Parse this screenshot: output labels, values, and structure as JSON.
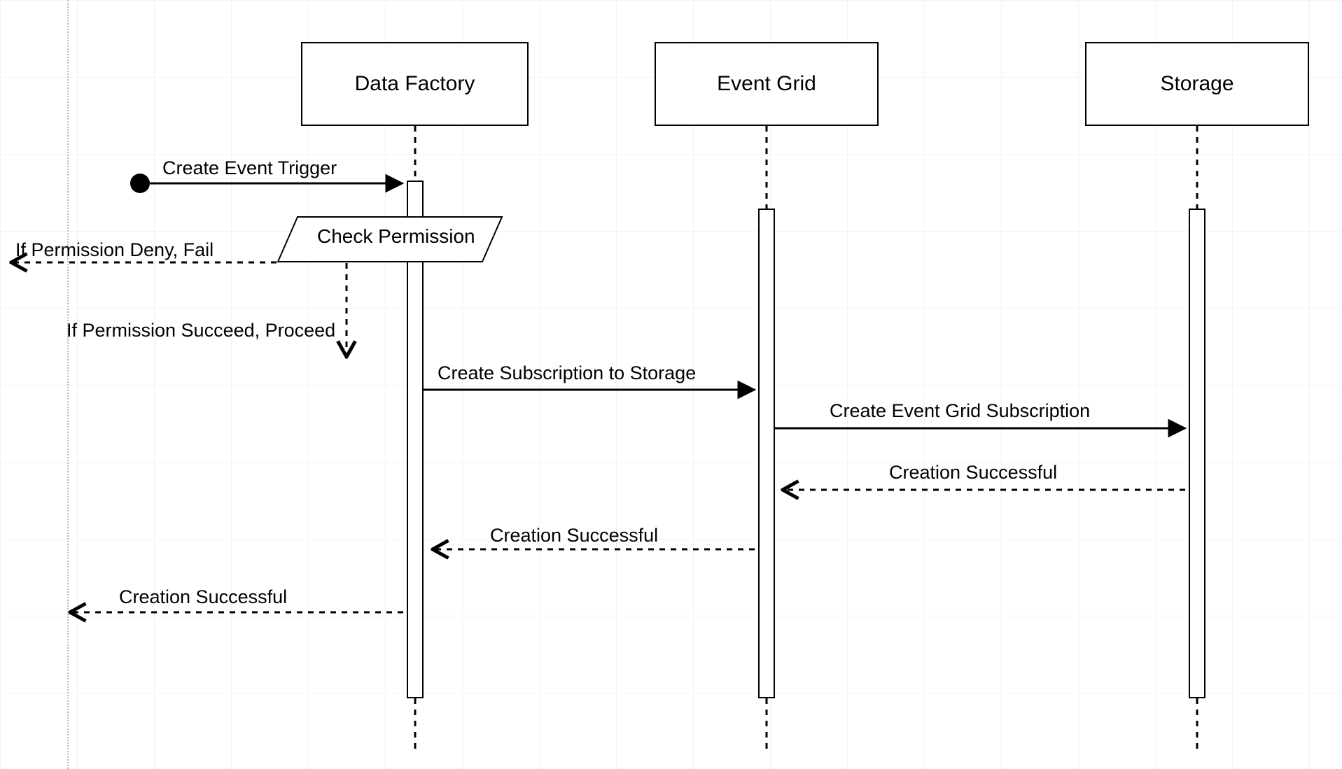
{
  "participants": {
    "dataFactory": "Data Factory",
    "eventGrid": "Event Grid",
    "storage": "Storage"
  },
  "messages": {
    "createEventTrigger": "Create Event Trigger",
    "checkPermission": "Check Permission",
    "permissionDenyFail": "If Permission Deny, Fail",
    "permissionSucceedProceed": "If Permission Succeed, Proceed",
    "createSubscriptionToStorage": "Create Subscription to Storage",
    "createEventGridSubscription": "Create Event Grid Subscription",
    "creationSuccessful1": "Creation Successful",
    "creationSuccessful2": "Creation Successful",
    "creationSuccessful3": "Creation Successful"
  },
  "diagram": {
    "type": "sequence",
    "participants": [
      "Data Factory",
      "Event Grid",
      "Storage"
    ],
    "sequence": [
      {
        "from": "Actor",
        "to": "Data Factory",
        "label": "Create Event Trigger",
        "style": "solid"
      },
      {
        "at": "Data Factory",
        "action": "Check Permission",
        "style": "decision"
      },
      {
        "from": "Data Factory",
        "to": "Actor",
        "label": "If Permission Deny, Fail",
        "style": "dashed"
      },
      {
        "at": "Data Factory",
        "label": "If Permission Succeed, Proceed",
        "style": "self-dashed"
      },
      {
        "from": "Data Factory",
        "to": "Event Grid",
        "label": "Create Subscription to Storage",
        "style": "solid"
      },
      {
        "from": "Event Grid",
        "to": "Storage",
        "label": "Create Event Grid Subscription",
        "style": "solid"
      },
      {
        "from": "Storage",
        "to": "Event Grid",
        "label": "Creation Successful",
        "style": "dashed"
      },
      {
        "from": "Event Grid",
        "to": "Data Factory",
        "label": "Creation Successful",
        "style": "dashed"
      },
      {
        "from": "Data Factory",
        "to": "Actor",
        "label": "Creation Successful",
        "style": "dashed"
      }
    ]
  }
}
